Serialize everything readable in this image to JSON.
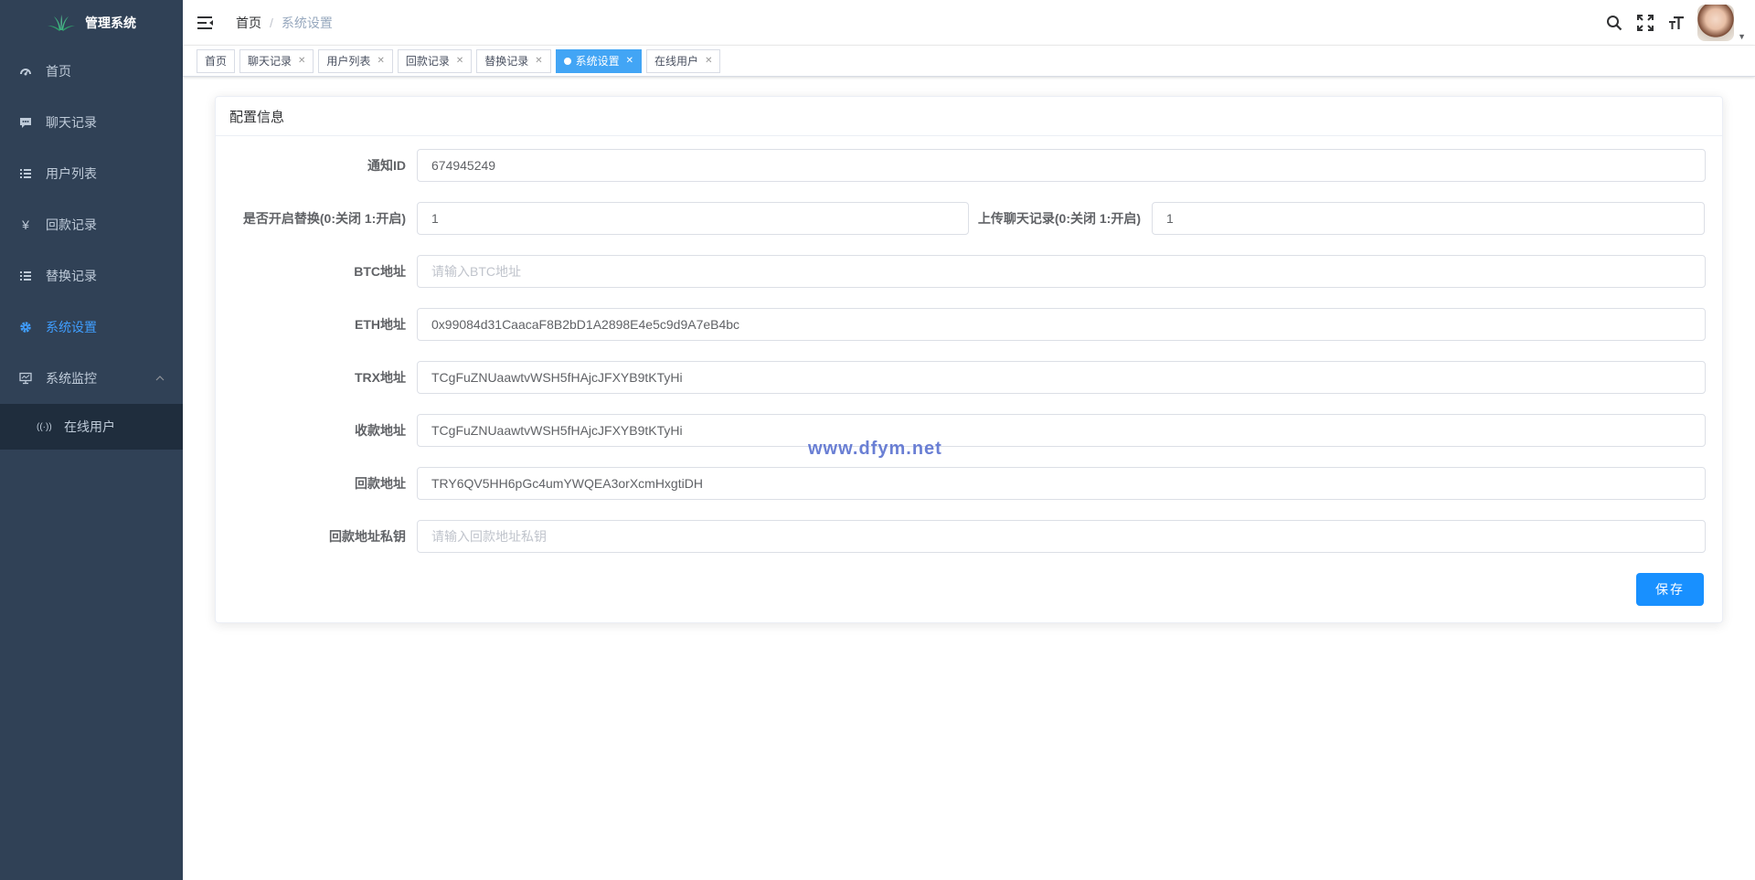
{
  "app": {
    "title": "管理系统"
  },
  "sidebar": {
    "items": [
      {
        "label": "首页",
        "icon": "dashboard-icon"
      },
      {
        "label": "聊天记录",
        "icon": "chat-icon"
      },
      {
        "label": "用户列表",
        "icon": "list-icon"
      },
      {
        "label": "回款记录",
        "icon": "yen-icon"
      },
      {
        "label": "替换记录",
        "icon": "list-icon"
      },
      {
        "label": "系统设置",
        "icon": "gear-icon",
        "active": true
      },
      {
        "label": "系统监控",
        "icon": "monitor-icon",
        "expanded": true
      }
    ],
    "sub_items": [
      {
        "label": "在线用户",
        "icon": "online-icon"
      }
    ]
  },
  "navbar": {
    "breadcrumb": {
      "home": "首页",
      "separator": "/",
      "current": "系统设置"
    }
  },
  "tags": [
    {
      "label": "首页",
      "closable": false
    },
    {
      "label": "聊天记录",
      "closable": true
    },
    {
      "label": "用户列表",
      "closable": true
    },
    {
      "label": "回款记录",
      "closable": true
    },
    {
      "label": "替换记录",
      "closable": true
    },
    {
      "label": "系统设置",
      "closable": true,
      "active": true
    },
    {
      "label": "在线用户",
      "closable": true
    }
  ],
  "form": {
    "title": "配置信息",
    "fields": {
      "notify_id": {
        "label": "通知ID",
        "value": "674945249"
      },
      "replace_enabled": {
        "label": "是否开启替换(0:关闭 1:开启)",
        "value": "1"
      },
      "upload_chat": {
        "label": "上传聊天记录(0:关闭 1:开启)",
        "value": "1"
      },
      "btc": {
        "label": "BTC地址",
        "value": "",
        "placeholder": "请输入BTC地址"
      },
      "eth": {
        "label": "ETH地址",
        "value": "0x99084d31CaacaF8B2bD1A2898E4e5c9d9A7eB4bc"
      },
      "trx": {
        "label": "TRX地址",
        "value": "TCgFuZNUaawtvWSH5fHAjcJFXYB9tKTyHi"
      },
      "receive": {
        "label": "收款地址",
        "value": "TCgFuZNUaawtvWSH5fHAjcJFXYB9tKTyHi"
      },
      "refund": {
        "label": "回款地址",
        "value": "TRY6QV5HH6pGc4umYWQEA3orXcmHxgtiDH"
      },
      "refund_key": {
        "label": "回款地址私钥",
        "value": "",
        "placeholder": "请输入回款地址私钥"
      }
    },
    "save_label": "保存"
  },
  "watermark": "www.dfym.net",
  "colors": {
    "sidebar_bg": "#304156",
    "accent": "#409eff",
    "button": "#1890ff",
    "tag_active": "#42a5f5"
  }
}
